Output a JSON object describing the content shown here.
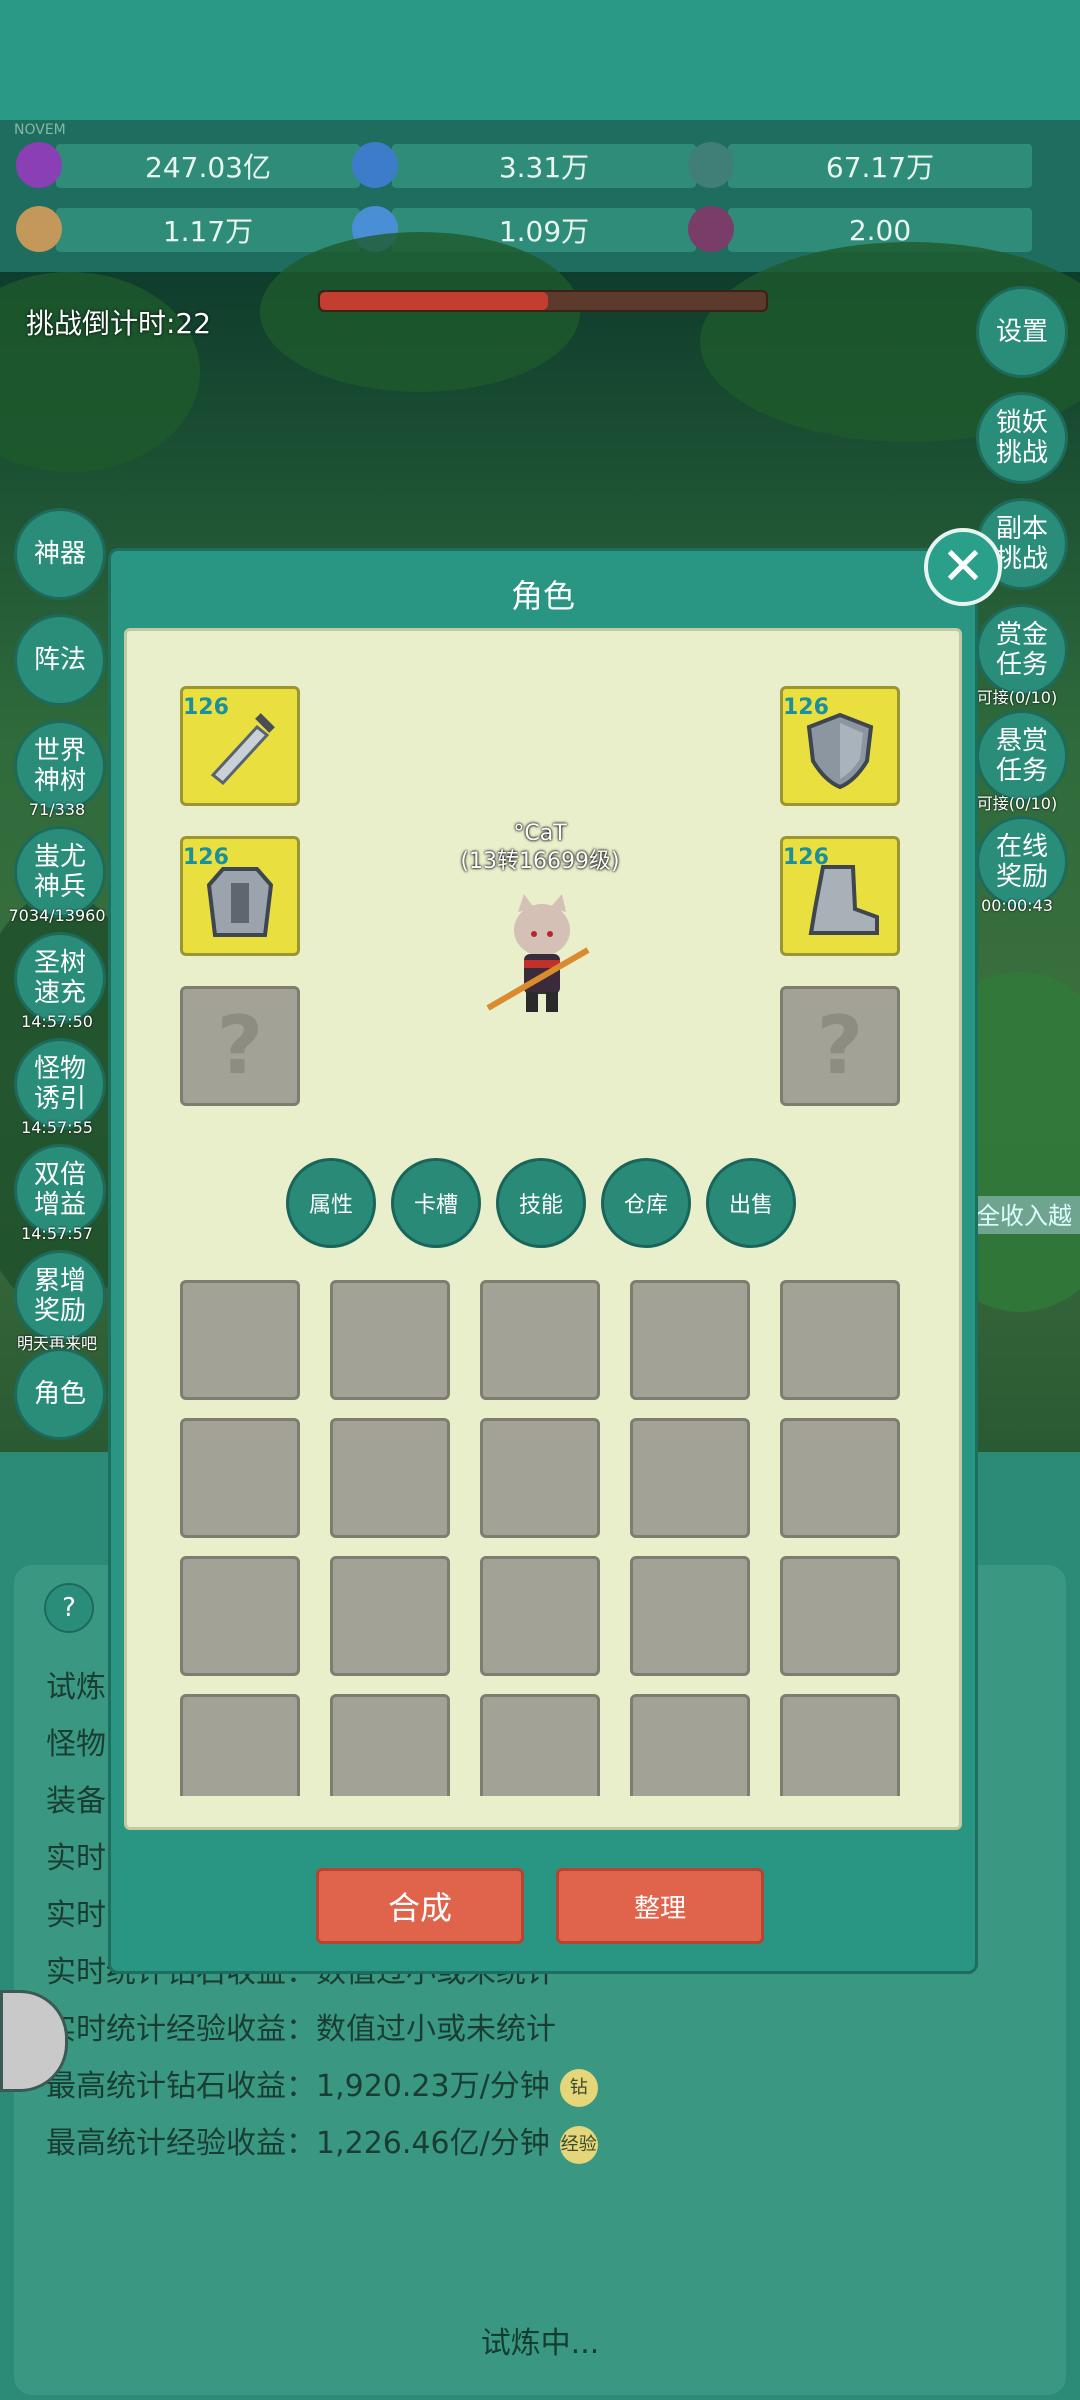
{
  "resources": [
    {
      "icon": "purple-gem-icon",
      "value": "247.03亿",
      "color": "#8a3fb5"
    },
    {
      "icon": "blue-crystal-icon",
      "value": "3.31万",
      "color": "#3d7cc9"
    },
    {
      "icon": "teal-ore-icon",
      "value": "67.17万",
      "color": "#3f7f78"
    },
    {
      "icon": "scroll-icon",
      "value": "1.17万",
      "color": "#c3985a"
    },
    {
      "icon": "ice-shard-icon",
      "value": "1.09万",
      "color": "#4a8fd6"
    },
    {
      "icon": "dark-orb-icon",
      "value": "2.00",
      "color": "#7a3d6a"
    }
  ],
  "countdown": "挑战倒计时:22",
  "left_buttons": [
    {
      "label": "神器",
      "sub": ""
    },
    {
      "label": "阵法",
      "sub": ""
    },
    {
      "label": "世界\n神树",
      "sub": "71/338"
    },
    {
      "label": "蚩尤\n神兵",
      "sub": "7034/13960"
    },
    {
      "label": "圣树\n速充",
      "sub": "14:57:50"
    },
    {
      "label": "怪物\n诱引",
      "sub": "14:57:55"
    },
    {
      "label": "双倍\n增益",
      "sub": "14:57:57"
    },
    {
      "label": "累增\n奖励",
      "sub": "明天再来吧"
    },
    {
      "label": "角色",
      "sub": ""
    }
  ],
  "right_buttons": [
    {
      "label": "设置",
      "sub": ""
    },
    {
      "label": "锁妖\n挑战",
      "sub": ""
    },
    {
      "label": "副本\n挑战",
      "sub": ""
    },
    {
      "label": "赏金\n任务",
      "sub": "可接(0/10)"
    },
    {
      "label": "悬赏\n任务",
      "sub": "可接(0/10)"
    },
    {
      "label": "在线\n奖励",
      "sub": "00:00:43"
    }
  ],
  "info_lines": [
    {
      "text": "试炼",
      "badge": ""
    },
    {
      "text": "怪物",
      "badge": ""
    },
    {
      "text": "装备",
      "badge": ""
    },
    {
      "text": "实时",
      "badge": ""
    },
    {
      "text": "实时",
      "badge": ""
    },
    {
      "text": "实时统计钻石收益：数值过小或未统计",
      "badge": ""
    },
    {
      "text": "实时统计经验收益：数值过小或未统计",
      "badge": ""
    },
    {
      "text": "最高统计钻石收益：1,920.23万/分钟",
      "badge": "钻"
    },
    {
      "text": "最高统计经验收益：1,226.46亿/分钟",
      "badge": "经验"
    }
  ],
  "status": "试炼中...",
  "scroll_text": "全收入越",
  "modal": {
    "title": "角色",
    "character_name": "°CaT",
    "character_level": "(13转16699级)",
    "equip_level": "126",
    "equipment": [
      {
        "slot": "weapon",
        "icon": "sword-icon"
      },
      {
        "slot": "shield",
        "icon": "shield-icon"
      },
      {
        "slot": "armor",
        "icon": "armor-icon"
      },
      {
        "slot": "boots",
        "icon": "boots-icon"
      }
    ],
    "empty_mark": "?",
    "tabs": [
      "属性",
      "卡槽",
      "技能",
      "仓库",
      "出售"
    ],
    "buttons": {
      "compose": "合成",
      "organize": "整理"
    }
  },
  "colors": {
    "teal": "#289683",
    "cream": "#e9efcb",
    "red_button": "#e0634b",
    "gold_slot": "#e9df3e"
  }
}
